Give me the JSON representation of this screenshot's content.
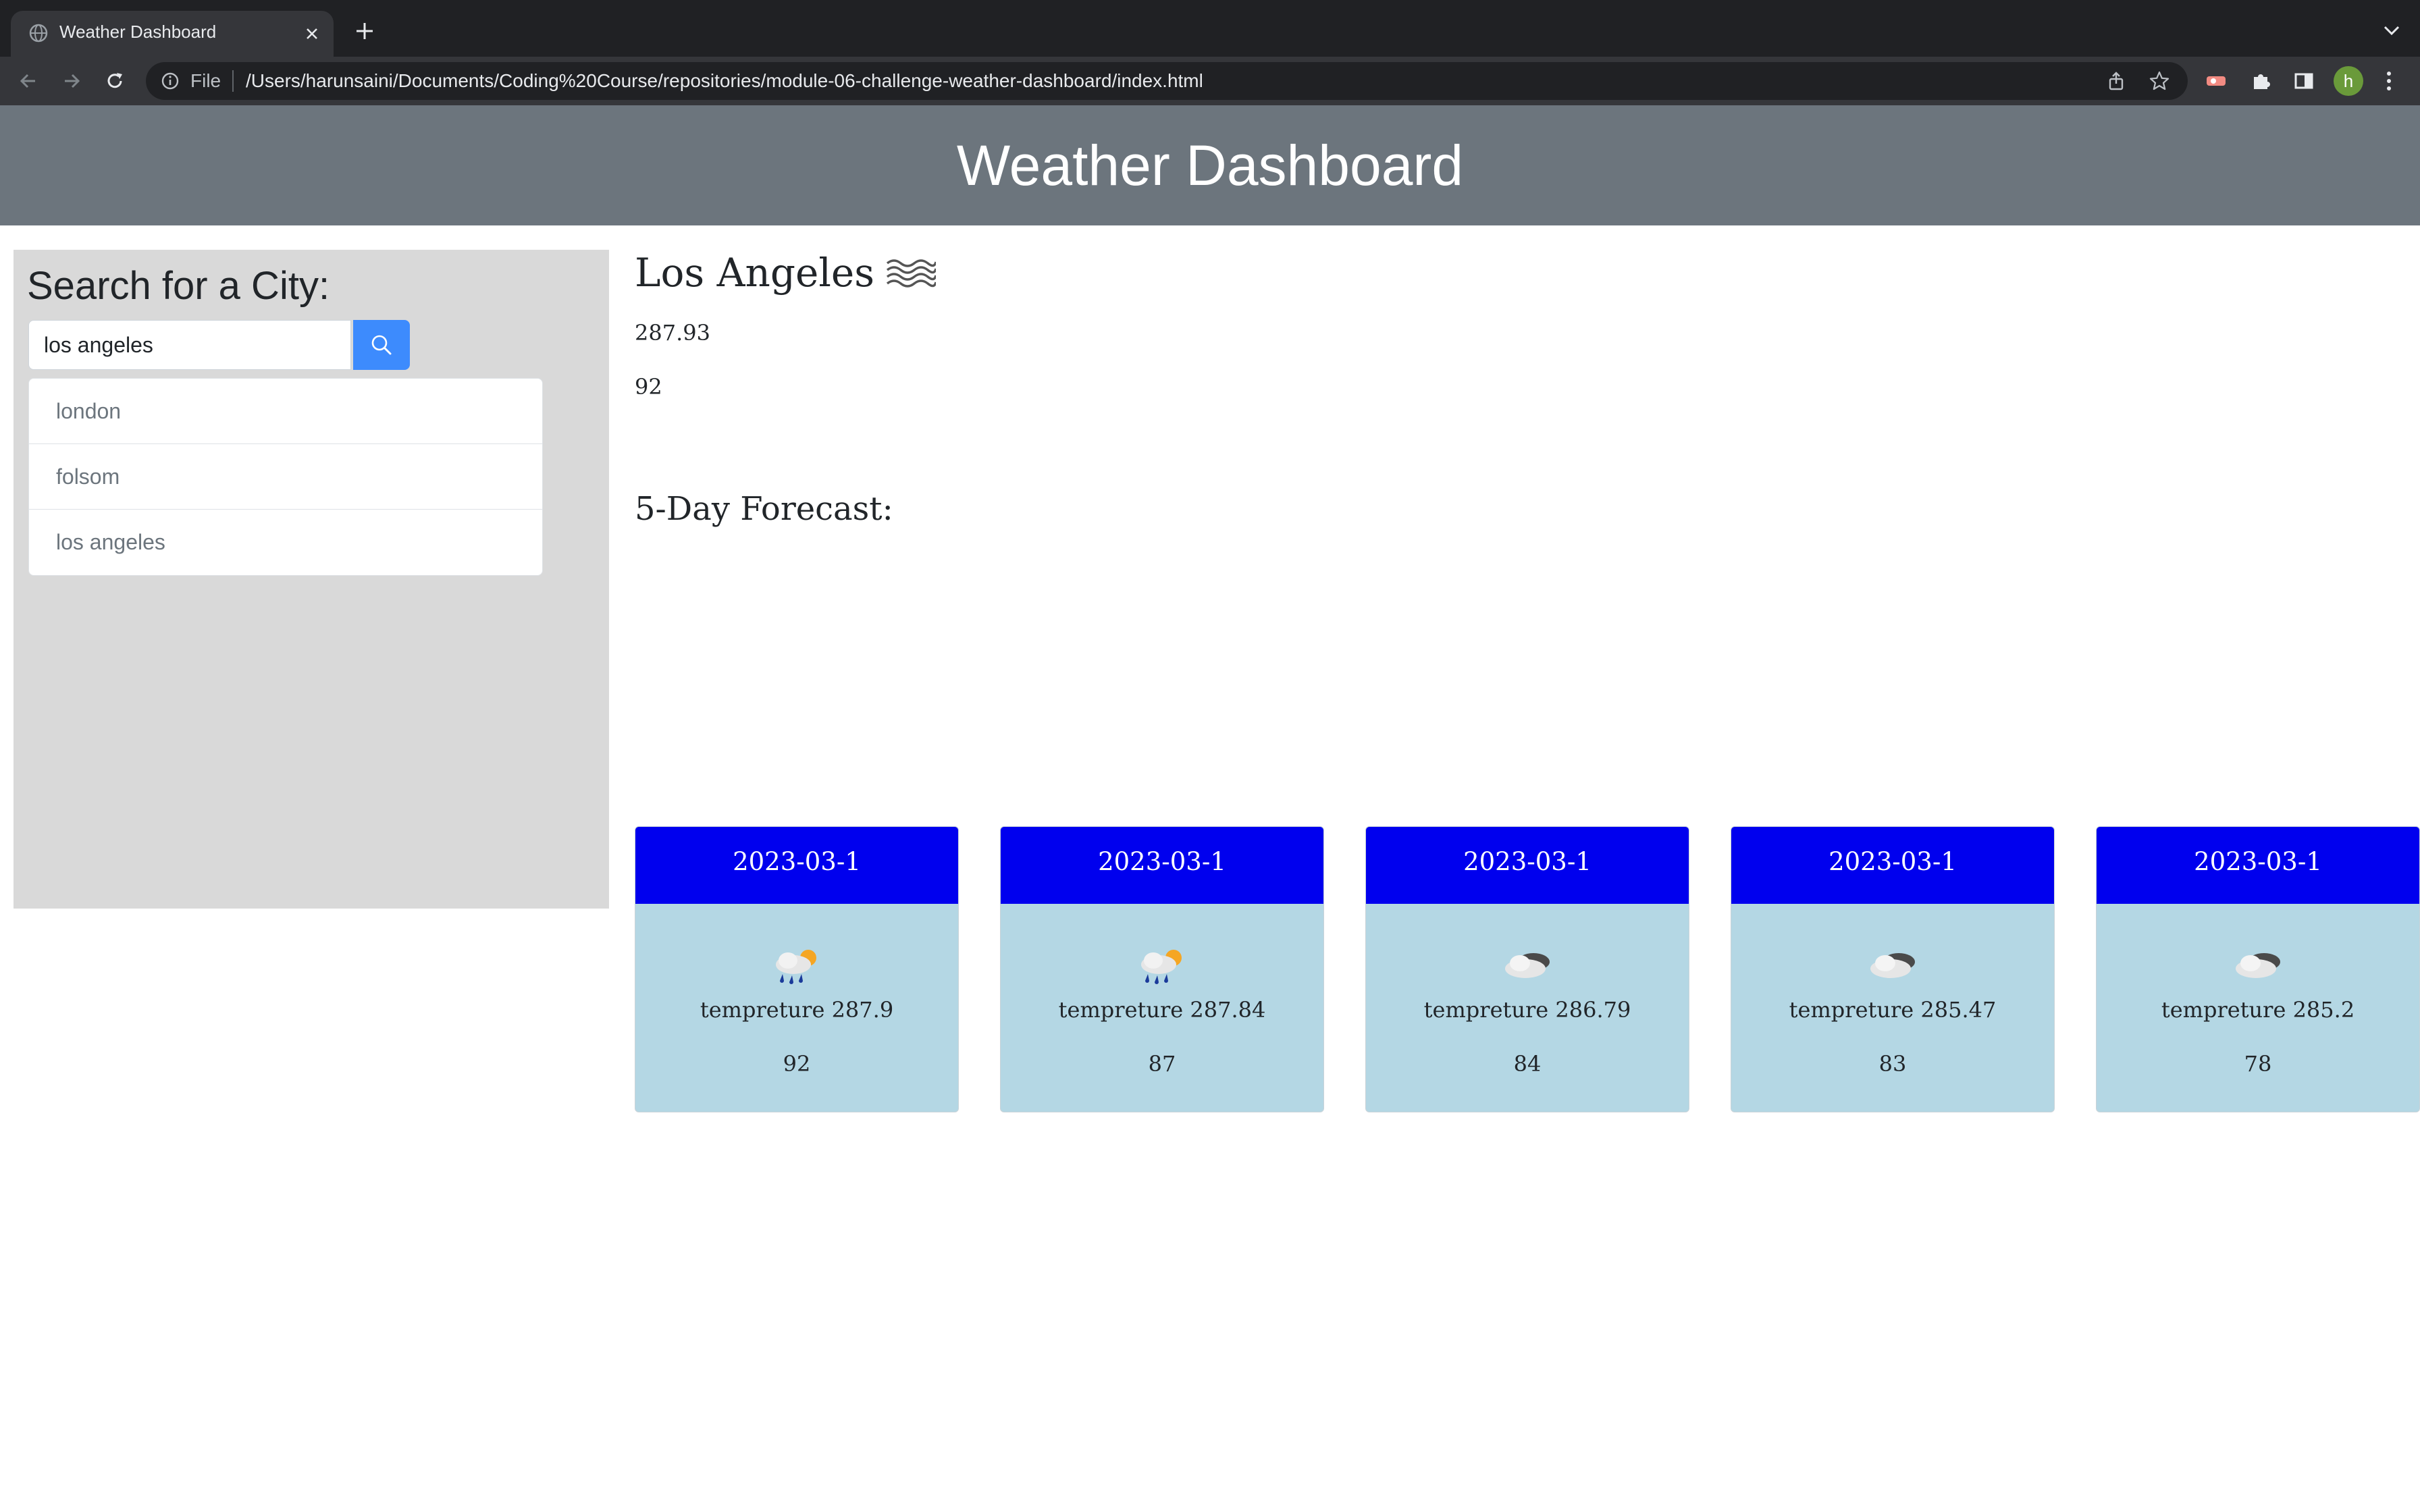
{
  "browser": {
    "tab_title": "Weather Dashboard",
    "url_scheme": "File",
    "url": "/Users/harunsaini/Documents/Coding%20Course/repositories/module-06-challenge-weather-dashboard/index.html",
    "profile_initial": "h"
  },
  "header": {
    "title": "Weather Dashboard"
  },
  "sidebar": {
    "heading": "Search for a City:",
    "search_value": "los angeles",
    "history": [
      "london",
      "folsom",
      "los angeles"
    ]
  },
  "current": {
    "city": "Los Angeles",
    "icon": "mist-icon",
    "temp": "287.93",
    "humidity": "92"
  },
  "forecast": {
    "title": "5-Day Forecast:",
    "days": [
      {
        "date": "2023-03-1",
        "icon": "rain-sun-icon",
        "temp": "tempreture 287.9",
        "humidity": "92"
      },
      {
        "date": "2023-03-1",
        "icon": "rain-sun-icon",
        "temp": "tempreture 287.84",
        "humidity": "87"
      },
      {
        "date": "2023-03-1",
        "icon": "cloud-icon",
        "temp": "tempreture 286.79",
        "humidity": "84"
      },
      {
        "date": "2023-03-1",
        "icon": "cloud-icon",
        "temp": "tempreture 285.47",
        "humidity": "83"
      },
      {
        "date": "2023-03-1",
        "icon": "cloud-icon",
        "temp": "tempreture 285.2",
        "humidity": "78"
      }
    ]
  },
  "colors": {
    "header_bg": "#6c757d",
    "sidebar_bg": "#d9d9d9",
    "search_button": "#3d8bfd",
    "card_header": "#0000ee",
    "card_body": "#b4d7e4"
  }
}
